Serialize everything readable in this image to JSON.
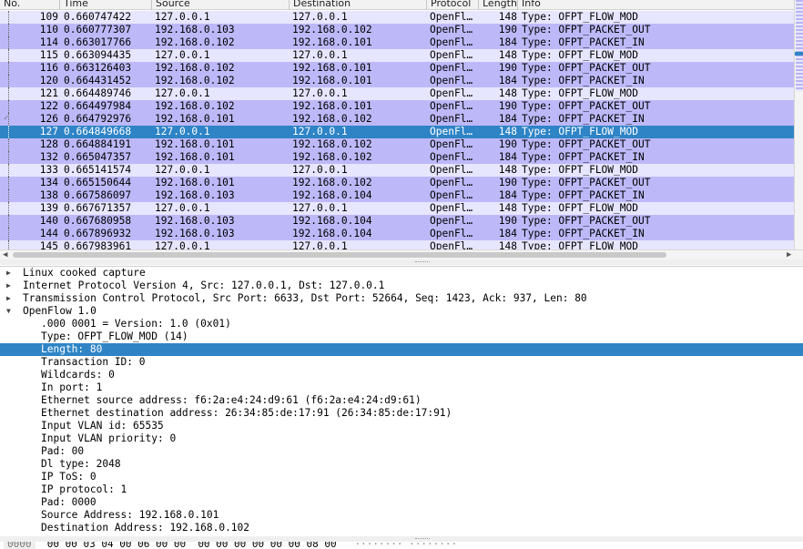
{
  "packet_list": {
    "columns": [
      "No.",
      "Time",
      "Source",
      "Destination",
      "Protocol",
      "Length",
      "Info"
    ],
    "rows": [
      {
        "no": "109",
        "time": "0.660747422",
        "src": "127.0.0.1",
        "dst": "127.0.0.1",
        "proto": "OpenFl…",
        "len": "148",
        "info": "Type: OFPT_FLOW_MOD",
        "kind": "flow"
      },
      {
        "no": "110",
        "time": "0.660777307",
        "src": "192.168.0.103",
        "dst": "192.168.0.102",
        "proto": "OpenFl…",
        "len": "190",
        "info": "Type: OFPT_PACKET_OUT",
        "kind": "pkt"
      },
      {
        "no": "114",
        "time": "0.663017766",
        "src": "192.168.0.102",
        "dst": "192.168.0.101",
        "proto": "OpenFl…",
        "len": "184",
        "info": "Type: OFPT_PACKET_IN",
        "kind": "pkt"
      },
      {
        "no": "115",
        "time": "0.663094435",
        "src": "127.0.0.1",
        "dst": "127.0.0.1",
        "proto": "OpenFl…",
        "len": "148",
        "info": "Type: OFPT_FLOW_MOD",
        "kind": "flow"
      },
      {
        "no": "116",
        "time": "0.663126403",
        "src": "192.168.0.102",
        "dst": "192.168.0.101",
        "proto": "OpenFl…",
        "len": "190",
        "info": "Type: OFPT_PACKET_OUT",
        "kind": "pkt"
      },
      {
        "no": "120",
        "time": "0.664431452",
        "src": "192.168.0.102",
        "dst": "192.168.0.101",
        "proto": "OpenFl…",
        "len": "184",
        "info": "Type: OFPT_PACKET_IN",
        "kind": "pkt"
      },
      {
        "no": "121",
        "time": "0.664489746",
        "src": "127.0.0.1",
        "dst": "127.0.0.1",
        "proto": "OpenFl…",
        "len": "148",
        "info": "Type: OFPT_FLOW_MOD",
        "kind": "flow"
      },
      {
        "no": "122",
        "time": "0.664497984",
        "src": "192.168.0.102",
        "dst": "192.168.0.101",
        "proto": "OpenFl…",
        "len": "190",
        "info": "Type: OFPT_PACKET_OUT",
        "kind": "pkt"
      },
      {
        "no": "126",
        "time": "0.664792976",
        "src": "192.168.0.101",
        "dst": "192.168.0.102",
        "proto": "OpenFl…",
        "len": "184",
        "info": "Type: OFPT_PACKET_IN",
        "kind": "pkt"
      },
      {
        "no": "127",
        "time": "0.664849668",
        "src": "127.0.0.1",
        "dst": "127.0.0.1",
        "proto": "OpenFl…",
        "len": "148",
        "info": "Type: OFPT_FLOW_MOD",
        "kind": "sel"
      },
      {
        "no": "128",
        "time": "0.664884191",
        "src": "192.168.0.101",
        "dst": "192.168.0.102",
        "proto": "OpenFl…",
        "len": "190",
        "info": "Type: OFPT_PACKET_OUT",
        "kind": "pkt"
      },
      {
        "no": "132",
        "time": "0.665047357",
        "src": "192.168.0.101",
        "dst": "192.168.0.102",
        "proto": "OpenFl…",
        "len": "184",
        "info": "Type: OFPT_PACKET_IN",
        "kind": "pkt"
      },
      {
        "no": "133",
        "time": "0.665141574",
        "src": "127.0.0.1",
        "dst": "127.0.0.1",
        "proto": "OpenFl…",
        "len": "148",
        "info": "Type: OFPT_FLOW_MOD",
        "kind": "flow"
      },
      {
        "no": "134",
        "time": "0.665150644",
        "src": "192.168.0.101",
        "dst": "192.168.0.102",
        "proto": "OpenFl…",
        "len": "190",
        "info": "Type: OFPT_PACKET_OUT",
        "kind": "pkt"
      },
      {
        "no": "138",
        "time": "0.667586097",
        "src": "192.168.0.103",
        "dst": "192.168.0.104",
        "proto": "OpenFl…",
        "len": "184",
        "info": "Type: OFPT_PACKET_IN",
        "kind": "pkt"
      },
      {
        "no": "139",
        "time": "0.667671357",
        "src": "127.0.0.1",
        "dst": "127.0.0.1",
        "proto": "OpenFl…",
        "len": "148",
        "info": "Type: OFPT_FLOW_MOD",
        "kind": "flow"
      },
      {
        "no": "140",
        "time": "0.667680958",
        "src": "192.168.0.103",
        "dst": "192.168.0.104",
        "proto": "OpenFl…",
        "len": "190",
        "info": "Type: OFPT_PACKET_OUT",
        "kind": "pkt"
      },
      {
        "no": "144",
        "time": "0.667896932",
        "src": "192.168.0.103",
        "dst": "192.168.0.104",
        "proto": "OpenFl…",
        "len": "184",
        "info": "Type: OFPT_PACKET_IN",
        "kind": "pkt"
      },
      {
        "no": "145",
        "time": "0.667983961",
        "src": "127.0.0.1",
        "dst": "127.0.0.1",
        "proto": "OpenFl…",
        "len": "148",
        "info": "Type: OFPT_FLOW_MOD",
        "kind": "flow"
      }
    ]
  },
  "details": {
    "items": [
      {
        "text": "Linux cooked capture",
        "level": 0,
        "expander": "collapsed"
      },
      {
        "text": "Internet Protocol Version 4, Src: 127.0.0.1, Dst: 127.0.0.1",
        "level": 0,
        "expander": "collapsed"
      },
      {
        "text": "Transmission Control Protocol, Src Port: 6633, Dst Port: 52664, Seq: 1423, Ack: 937, Len: 80",
        "level": 0,
        "expander": "collapsed"
      },
      {
        "text": "OpenFlow 1.0",
        "level": 0,
        "expander": "expanded"
      },
      {
        "text": ".000 0001 = Version: 1.0 (0x01)",
        "level": 1
      },
      {
        "text": "Type: OFPT_FLOW_MOD (14)",
        "level": 1
      },
      {
        "text": "Length: 80",
        "level": 1,
        "selected": true
      },
      {
        "text": "Transaction ID: 0",
        "level": 1
      },
      {
        "text": "Wildcards: 0",
        "level": 1
      },
      {
        "text": "In port: 1",
        "level": 1
      },
      {
        "text": "Ethernet source address: f6:2a:e4:24:d9:61 (f6:2a:e4:24:d9:61)",
        "level": 1
      },
      {
        "text": "Ethernet destination address: 26:34:85:de:17:91 (26:34:85:de:17:91)",
        "level": 1
      },
      {
        "text": "Input VLAN id: 65535",
        "level": 1
      },
      {
        "text": "Input VLAN priority: 0",
        "level": 1
      },
      {
        "text": "Pad: 00",
        "level": 1
      },
      {
        "text": "Dl type: 2048",
        "level": 1
      },
      {
        "text": "IP ToS: 0",
        "level": 1
      },
      {
        "text": "IP protocol: 1",
        "level": 1
      },
      {
        "text": "Pad: 0000",
        "level": 1
      },
      {
        "text": "Source Address: 192.168.0.101",
        "level": 1
      },
      {
        "text": "Destination Address: 192.168.0.102",
        "level": 1
      }
    ]
  },
  "bytes": {
    "offset": "0000",
    "hex": "00 00 03 04 00 06 00 00  00 00 00 00 00 00 08 00",
    "ascii": "········ ········"
  },
  "icons": {
    "collapsed": "triangle-right-icon",
    "expanded": "triangle-down-icon",
    "ack": "check-mark-icon"
  },
  "colors": {
    "flow_mod_row": "#e7e6ff",
    "packet_row": "#bdb9f9",
    "selection": "#2e84c5"
  }
}
